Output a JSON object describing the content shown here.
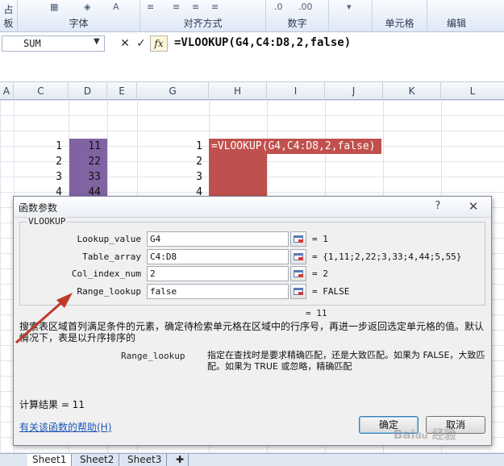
{
  "ribbon": {
    "groups": [
      {
        "label": "占板"
      },
      {
        "label": "字体"
      },
      {
        "label": "对齐方式"
      },
      {
        "label": "数字"
      },
      {
        "label": "单元格"
      },
      {
        "label": "编辑"
      }
    ]
  },
  "formula_bar": {
    "name_box": "SUM",
    "cancel": "✕",
    "enter": "✓",
    "fx": "fx",
    "formula": "=VLOOKUP(G4,C4:D8,2,false)"
  },
  "columns": [
    "A",
    "C",
    "D",
    "E",
    "G",
    "H",
    "I",
    "J",
    "K",
    "L"
  ],
  "cells": {
    "c": [
      "1",
      "2",
      "3",
      "4"
    ],
    "d": [
      "11",
      "22",
      "33",
      "44"
    ],
    "g": [
      "1",
      "2",
      "3",
      "4"
    ],
    "h_formula": "=VLOOKUP(G4,C4:D8,2,false)"
  },
  "sheet_tabs": [
    "Sheet1",
    "Sheet2",
    "Sheet3"
  ],
  "dialog": {
    "title": "函数参数",
    "help_button": "?",
    "close_button": "✕",
    "function_name": "VLOOKUP",
    "params": [
      {
        "label": "Lookup_value",
        "value": "G4",
        "result": "=  1"
      },
      {
        "label": "Table_array",
        "value": "C4:D8",
        "result": "=  {1,11;2,22;3,33;4,44;5,55}"
      },
      {
        "label": "Col_index_num",
        "value": "2",
        "result": "=  2"
      },
      {
        "label": "Range_lookup",
        "value": "false",
        "result": "=  FALSE"
      }
    ],
    "overall_result": "=  11",
    "description": "搜索表区域首列满足条件的元素，确定待检索单元格在区域中的行序号，再进一步返回选定单元格的值。默认情况下，表是以升序排序的",
    "param_help_name": "Range_lookup",
    "param_help_text": "指定在查找时是要求精确匹配，还是大致匹配。如果为 FALSE，大致匹配。如果为 TRUE 或忽略，精确匹配",
    "calc_result": "计算结果 =  11",
    "help_link": "有关该函数的帮助(H)",
    "ok": "确定",
    "cancel": "取消"
  },
  "colors": {
    "purple_fill": "#8064a2",
    "red_fill": "#c0504d",
    "annotation_arrow": "#c0392b"
  }
}
